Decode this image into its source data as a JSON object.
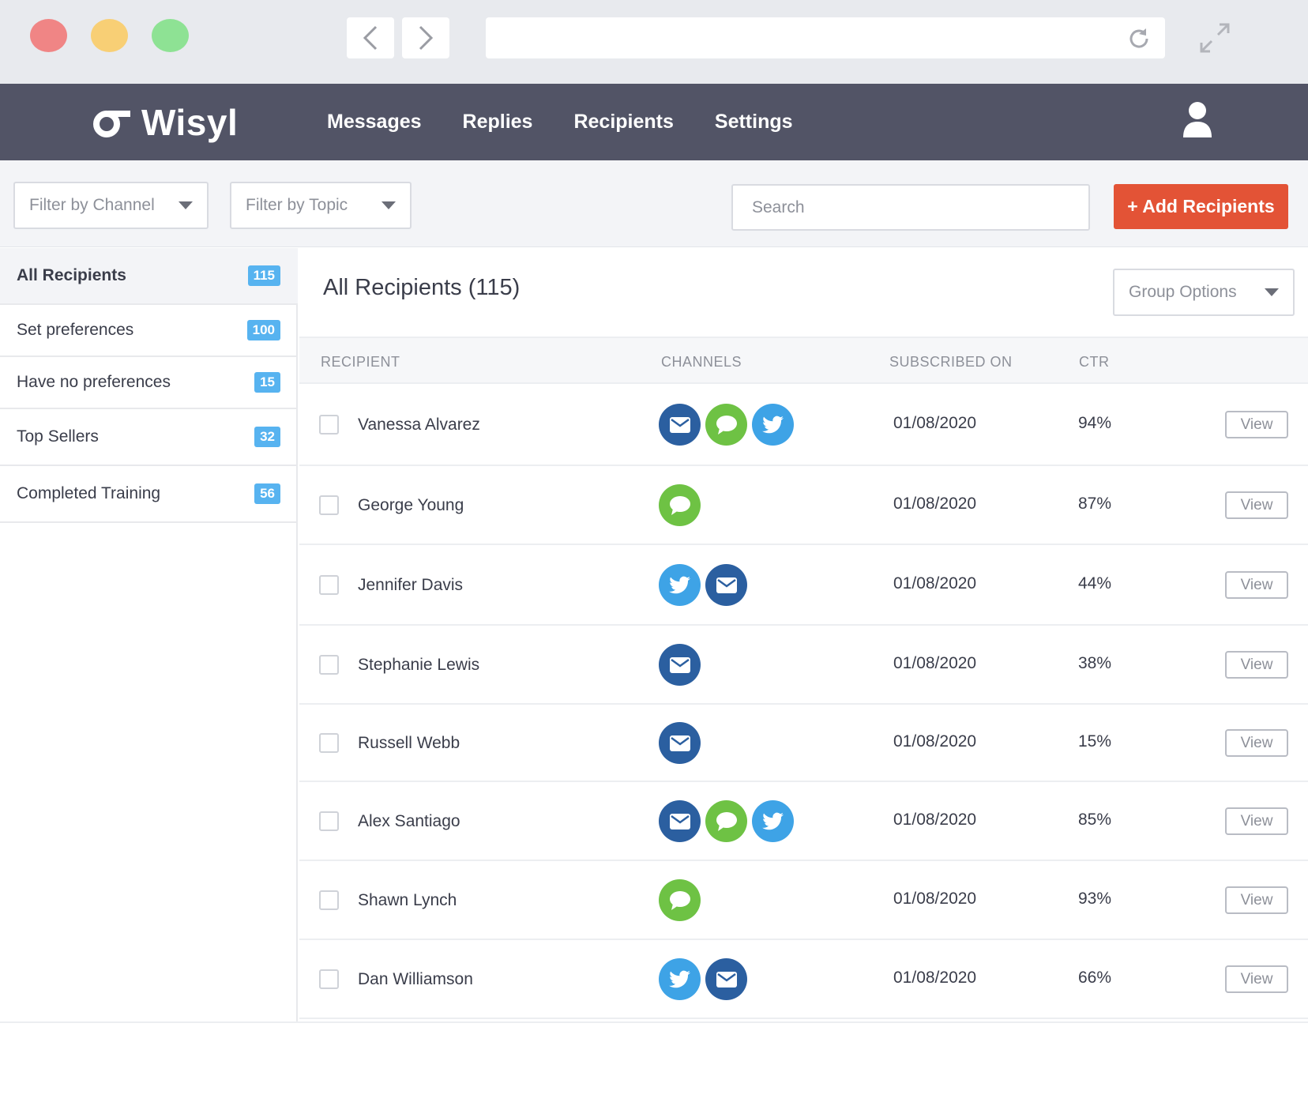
{
  "app": {
    "logo_text": "Wisyl",
    "menu": [
      {
        "label": "Messages"
      },
      {
        "label": "Replies"
      },
      {
        "label": "Recipients"
      },
      {
        "label": "Settings"
      }
    ]
  },
  "filters": {
    "channel_label": "Filter by Channel",
    "topic_label": "Filter by Topic",
    "search_placeholder": "Search",
    "add_button": "+ Add Recipients"
  },
  "sidebar": {
    "items": [
      {
        "label": "All Recipients",
        "count": "115",
        "active": true
      },
      {
        "label": "Set preferences",
        "count": "100"
      },
      {
        "label": "Have no preferences",
        "count": "15"
      },
      {
        "label": "Top Sellers",
        "count": "32"
      },
      {
        "label": "Completed Training",
        "count": "56"
      }
    ]
  },
  "main": {
    "title": "All Recipients (115)",
    "group_options": "Group Options",
    "columns": {
      "recipient": "RECIPIENT",
      "channels": "CHANNELS",
      "subscribed": "SUBSCRIBED ON",
      "ctr": "CTR"
    },
    "view_label": "View",
    "rows": [
      {
        "name": "Vanessa Alvarez",
        "channels": [
          "email",
          "sms",
          "twitter"
        ],
        "date": "01/08/2020",
        "ctr": "94%"
      },
      {
        "name": "George Young",
        "channels": [
          "sms"
        ],
        "date": "01/08/2020",
        "ctr": "87%"
      },
      {
        "name": "Jennifer Davis",
        "channels": [
          "twitter",
          "email"
        ],
        "date": "01/08/2020",
        "ctr": "44%"
      },
      {
        "name": "Stephanie Lewis",
        "channels": [
          "email"
        ],
        "date": "01/08/2020",
        "ctr": "38%"
      },
      {
        "name": "Russell Webb",
        "channels": [
          "email"
        ],
        "date": "01/08/2020",
        "ctr": "15%"
      },
      {
        "name": "Alex Santiago",
        "channels": [
          "email",
          "sms",
          "twitter"
        ],
        "date": "01/08/2020",
        "ctr": "85%"
      },
      {
        "name": "Shawn Lynch",
        "channels": [
          "sms"
        ],
        "date": "01/08/2020",
        "ctr": "93%"
      },
      {
        "name": "Dan Williamson",
        "channels": [
          "twitter",
          "email"
        ],
        "date": "01/08/2020",
        "ctr": "66%"
      }
    ]
  },
  "colors": {
    "header_bg": "#525466",
    "accent": "#e35336",
    "badge": "#57b3f0",
    "email": "#2b5fa0",
    "sms": "#6ec244",
    "twitter": "#3ea3e6"
  }
}
